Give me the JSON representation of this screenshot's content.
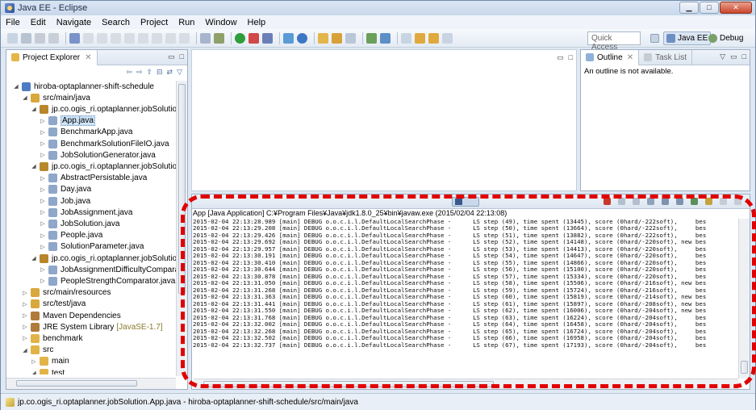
{
  "window": {
    "title": "Java EE - Eclipse"
  },
  "menu": [
    "File",
    "Edit",
    "Navigate",
    "Search",
    "Project",
    "Run",
    "Window",
    "Help"
  ],
  "toolbar": {
    "quick_access": "Quick Access",
    "perspectives": [
      "Java EE",
      "Debug"
    ]
  },
  "project_explorer": {
    "tab_label": "Project Explorer",
    "items": [
      {
        "label": "hiroba-optaplanner-shift-schedule",
        "type": "project",
        "expanded": true
      },
      {
        "label": "src/main/java",
        "type": "source-folder",
        "expanded": true
      },
      {
        "label": "jp.co.ogis_ri.optaplanner.jobSolution",
        "type": "package",
        "expanded": true
      },
      {
        "label": "App.java",
        "type": "java-file",
        "selected": true
      },
      {
        "label": "BenchmarkApp.java",
        "type": "java-file"
      },
      {
        "label": "BenchmarkSolutionFileIO.java",
        "type": "java-file"
      },
      {
        "label": "JobSolutionGenerator.java",
        "type": "java-file"
      },
      {
        "label": "jp.co.ogis_ri.optaplanner.jobSolution.domain",
        "type": "package",
        "expanded": true
      },
      {
        "label": "AbstractPersistable.java",
        "type": "java-file"
      },
      {
        "label": "Day.java",
        "type": "java-file"
      },
      {
        "label": "Job.java",
        "type": "java-file"
      },
      {
        "label": "JobAssignment.java",
        "type": "java-file"
      },
      {
        "label": "JobSolution.java",
        "type": "java-file"
      },
      {
        "label": "People.java",
        "type": "java-file"
      },
      {
        "label": "SolutionParameter.java",
        "type": "java-file"
      },
      {
        "label": "jp.co.ogis_ri.optaplanner.jobSolution.domain.solver",
        "type": "package",
        "expanded": true
      },
      {
        "label": "JobAssignmentDifficultyComparator.java",
        "type": "java-file"
      },
      {
        "label": "PeopleStrengthComparator.java",
        "type": "java-file"
      },
      {
        "label": "src/main/resources",
        "type": "source-folder"
      },
      {
        "label": "src/test/java",
        "type": "source-folder"
      },
      {
        "label": "Maven Dependencies",
        "type": "library"
      },
      {
        "label": "JRE System Library",
        "suffix": "[JavaSE-1.7]",
        "type": "library"
      },
      {
        "label": "benchmark",
        "type": "folder"
      },
      {
        "label": "src",
        "type": "folder",
        "expanded": true
      },
      {
        "label": "main",
        "type": "folder"
      },
      {
        "label": "test",
        "type": "folder",
        "expanded": true
      },
      {
        "label": "java",
        "type": "folder"
      }
    ]
  },
  "outline": {
    "tab_label": "Outline",
    "other_tab_label": "Task List",
    "message": "An outline is not available."
  },
  "console": {
    "header": "App [Java Application] C:¥Program Files¥Java¥jdk1.8.0_25¥bin¥javaw.exe (2015/02/04 22:13:08)",
    "lines": [
      "2015-02-04 22:13:28.989 [main] DEBUG o.o.c.i.l.DefaultLocalSearchPhase -      LS step (49), time spent (13445), score (0hard/-222soft),     bes",
      "2015-02-04 22:13:29.208 [main] DEBUG o.o.c.i.l.DefaultLocalSearchPhase -      LS step (50), time spent (13664), score (0hard/-222soft),     bes",
      "2015-02-04 22:13:29.426 [main] DEBUG o.o.c.i.l.DefaultLocalSearchPhase -      LS step (51), time spent (13882), score (0hard/-222soft),     bes",
      "2015-02-04 22:13:29.692 [main] DEBUG o.o.c.i.l.DefaultLocalSearchPhase -      LS step (52), time spent (14148), score (0hard/-220soft), new bes",
      "2015-02-04 22:13:29.957 [main] DEBUG o.o.c.i.l.DefaultLocalSearchPhase -      LS step (53), time spent (14413), score (0hard/-220soft),     bes",
      "2015-02-04 22:13:30.191 [main] DEBUG o.o.c.i.l.DefaultLocalSearchPhase -      LS step (54), time spent (14647), score (0hard/-220soft),     bes",
      "2015-02-04 22:13:30.410 [main] DEBUG o.o.c.i.l.DefaultLocalSearchPhase -      LS step (55), time spent (14866), score (0hard/-220soft),     bes",
      "2015-02-04 22:13:30.644 [main] DEBUG o.o.c.i.l.DefaultLocalSearchPhase -      LS step (56), time spent (15100), score (0hard/-220soft),     bes",
      "2015-02-04 22:13:30.878 [main] DEBUG o.o.c.i.l.DefaultLocalSearchPhase -      LS step (57), time spent (15334), score (0hard/-220soft),     bes",
      "2015-02-04 22:13:31.050 [main] DEBUG o.o.c.i.l.DefaultLocalSearchPhase -      LS step (58), time spent (15506), score (0hard/-216soft), new bes",
      "2015-02-04 22:13:31.268 [main] DEBUG o.o.c.i.l.DefaultLocalSearchPhase -      LS step (59), time spent (15724), score (0hard/-216soft),     bes",
      "2015-02-04 22:13:31.363 [main] DEBUG o.o.c.i.l.DefaultLocalSearchPhase -      LS step (60), time spent (15819), score (0hard/-214soft), new bes",
      "2015-02-04 22:13:31.441 [main] DEBUG o.o.c.i.l.DefaultLocalSearchPhase -      LS step (61), time spent (15897), score (0hard/-208soft), new bes",
      "2015-02-04 22:13:31.550 [main] DEBUG o.o.c.i.l.DefaultLocalSearchPhase -      LS step (62), time spent (16006), score (0hard/-204soft), new bes",
      "2015-02-04 22:13:31.768 [main] DEBUG o.o.c.i.l.DefaultLocalSearchPhase -      LS step (63), time spent (16224), score (0hard/-204soft),     bes",
      "2015-02-04 22:13:32.002 [main] DEBUG o.o.c.i.l.DefaultLocalSearchPhase -      LS step (64), time spent (16458), score (0hard/-204soft),     bes",
      "2015-02-04 22:13:32.268 [main] DEBUG o.o.c.i.l.DefaultLocalSearchPhase -      LS step (65), time spent (16724), score (0hard/-204soft),     bes",
      "2015-02-04 22:13:32.502 [main] DEBUG o.o.c.i.l.DefaultLocalSearchPhase -      LS step (66), time spent (16958), score (0hard/-204soft),     bes",
      "2015-02-04 22:13:32.737 [main] DEBUG o.o.c.i.l.DefaultLocalSearchPhase -      LS step (67), time spent (17193), score (0hard/-204soft),     bes"
    ]
  },
  "status": {
    "text": "jp.co.ogis_ri.optaplanner.jobSolution.App.java - hiroba-optaplanner-shift-schedule/src/main/java"
  },
  "colors": {
    "highlight": "#e10000",
    "selection": "#cde3f7"
  }
}
